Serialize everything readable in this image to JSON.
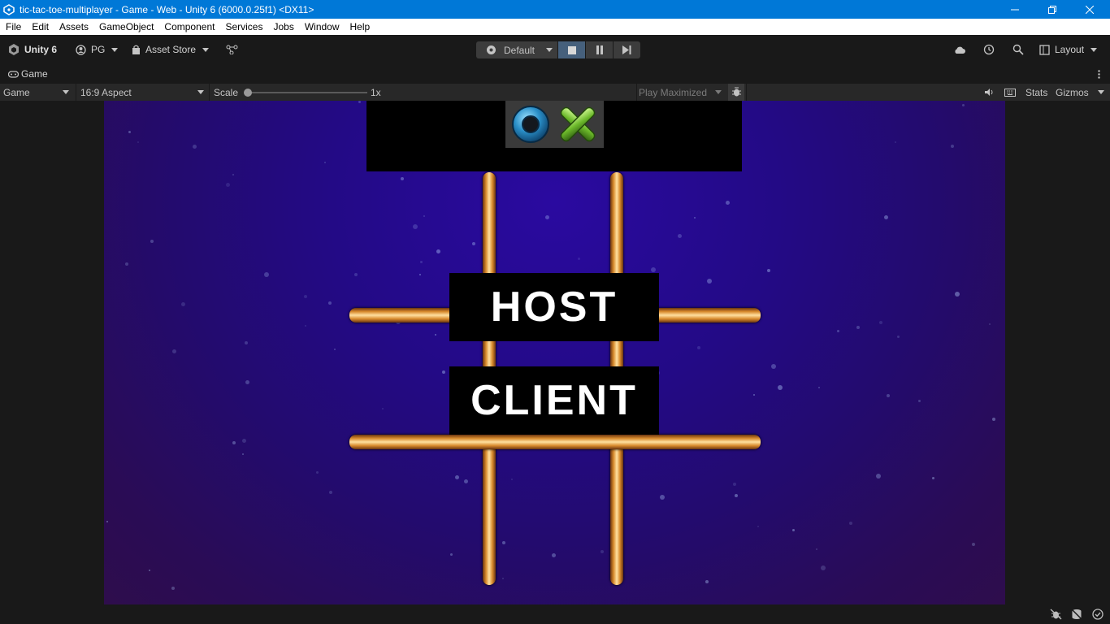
{
  "window": {
    "title": "tic-tac-toe-multiplayer - Game - Web - Unity 6 (6000.0.25f1) <DX11>"
  },
  "menu": [
    "File",
    "Edit",
    "Assets",
    "GameObject",
    "Component",
    "Services",
    "Jobs",
    "Window",
    "Help"
  ],
  "toolbar": {
    "unity_label": "Unity 6",
    "account_label": "PG",
    "asset_store_label": "Asset Store",
    "default_label": "Default",
    "layout_label": "Layout"
  },
  "tab": {
    "label": "Game"
  },
  "gamebar": {
    "display_label": "Game",
    "aspect_label": "16:9 Aspect",
    "scale_label": "Scale",
    "scale_value": "1x",
    "scale_fraction": 0.0,
    "play_label": "Play Maximized",
    "stats_label": "Stats",
    "gizmos_label": "Gizmos"
  },
  "game": {
    "host_label": "HOST",
    "client_label": "CLIENT"
  }
}
